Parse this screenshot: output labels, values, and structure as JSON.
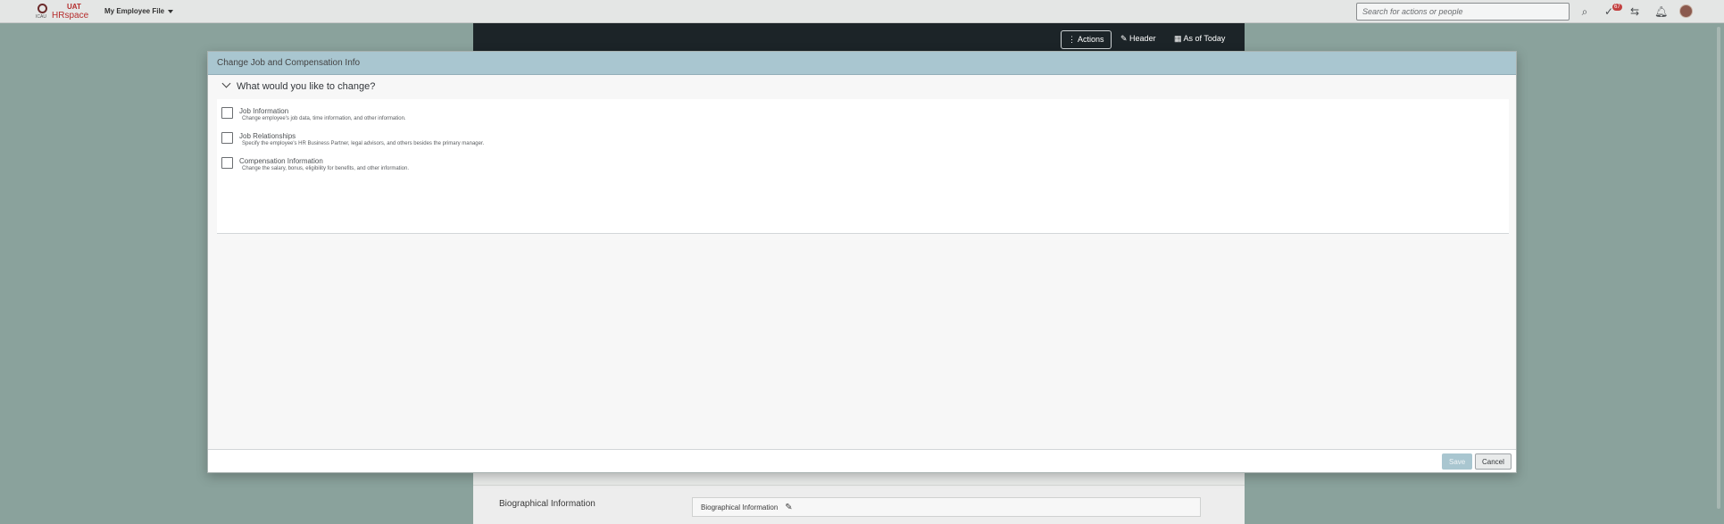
{
  "topbar": {
    "logo_uat": "UAT",
    "logo_hr": "HRspace",
    "logo_small": "ICAU",
    "module_title": "My Employee File",
    "search_placeholder": "Search for actions or people",
    "notification_count": "67"
  },
  "profile": {
    "actions_label": "Actions",
    "header_label": "Header",
    "as_of_label": "As of Today",
    "bio_section_label": "Biographical Information",
    "bio_card_label": "Biographical Information"
  },
  "dialog": {
    "title": "Change Job and Compensation Info",
    "section_title": "What would you like to change?",
    "options": [
      {
        "label": "Job Information",
        "description": "Change employee's job data, time information, and other information.",
        "checked": false
      },
      {
        "label": "Job Relationships",
        "description": "Specify the employee's HR Business Partner, legal advisors, and others besides the primary manager.",
        "checked": false
      },
      {
        "label": "Compensation Information",
        "description": "Change the salary, bonus, eligibility for benefits, and other information.",
        "checked": false
      }
    ],
    "save_label": "Save",
    "cancel_label": "Cancel"
  },
  "colors": {
    "overlay_bg": "#8aa29c",
    "dialog_header": "#a9c6d0",
    "save_disabled": "#a9c6d0"
  }
}
